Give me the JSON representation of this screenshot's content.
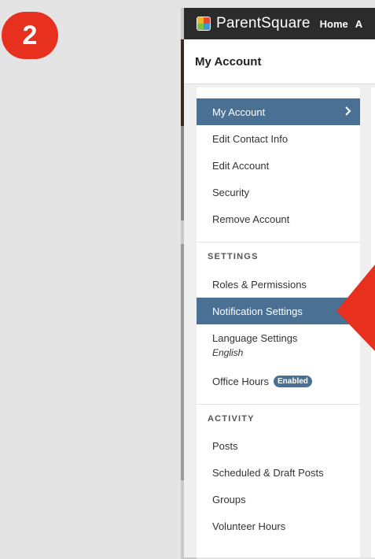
{
  "step_badge": "2",
  "header": {
    "brand": "ParentSquare",
    "nav_home": "Home",
    "nav_more": "A"
  },
  "page_title": "My Account",
  "menu": {
    "account_items": [
      {
        "label": "My Account",
        "active": true
      },
      {
        "label": "Edit Contact Info"
      },
      {
        "label": "Edit Account"
      },
      {
        "label": "Security"
      },
      {
        "label": "Remove Account"
      }
    ],
    "settings_heading": "SETTINGS",
    "settings_items": [
      {
        "label": "Roles & Permissions"
      },
      {
        "label": "Notification Settings",
        "highlighted": true
      }
    ],
    "language": {
      "label": "Language Settings",
      "value": "English"
    },
    "office_hours": {
      "label": "Office Hours",
      "badge": "Enabled"
    },
    "activity_heading": "ACTIVITY",
    "activity_items": [
      {
        "label": "Posts"
      },
      {
        "label": "Scheduled & Draft Posts"
      },
      {
        "label": "Groups"
      },
      {
        "label": "Volunteer Hours"
      }
    ]
  },
  "colors": {
    "active_bg": "#4a7194",
    "topbar_bg": "#2b2b2b",
    "callout_red": "#e8301e",
    "page_bg": "#e4e4e4"
  },
  "icons": {
    "logo": "parentsquare-logo-icon",
    "chevron": "chevron-right-icon",
    "pointer": "red-arrow-pointer-icon"
  }
}
